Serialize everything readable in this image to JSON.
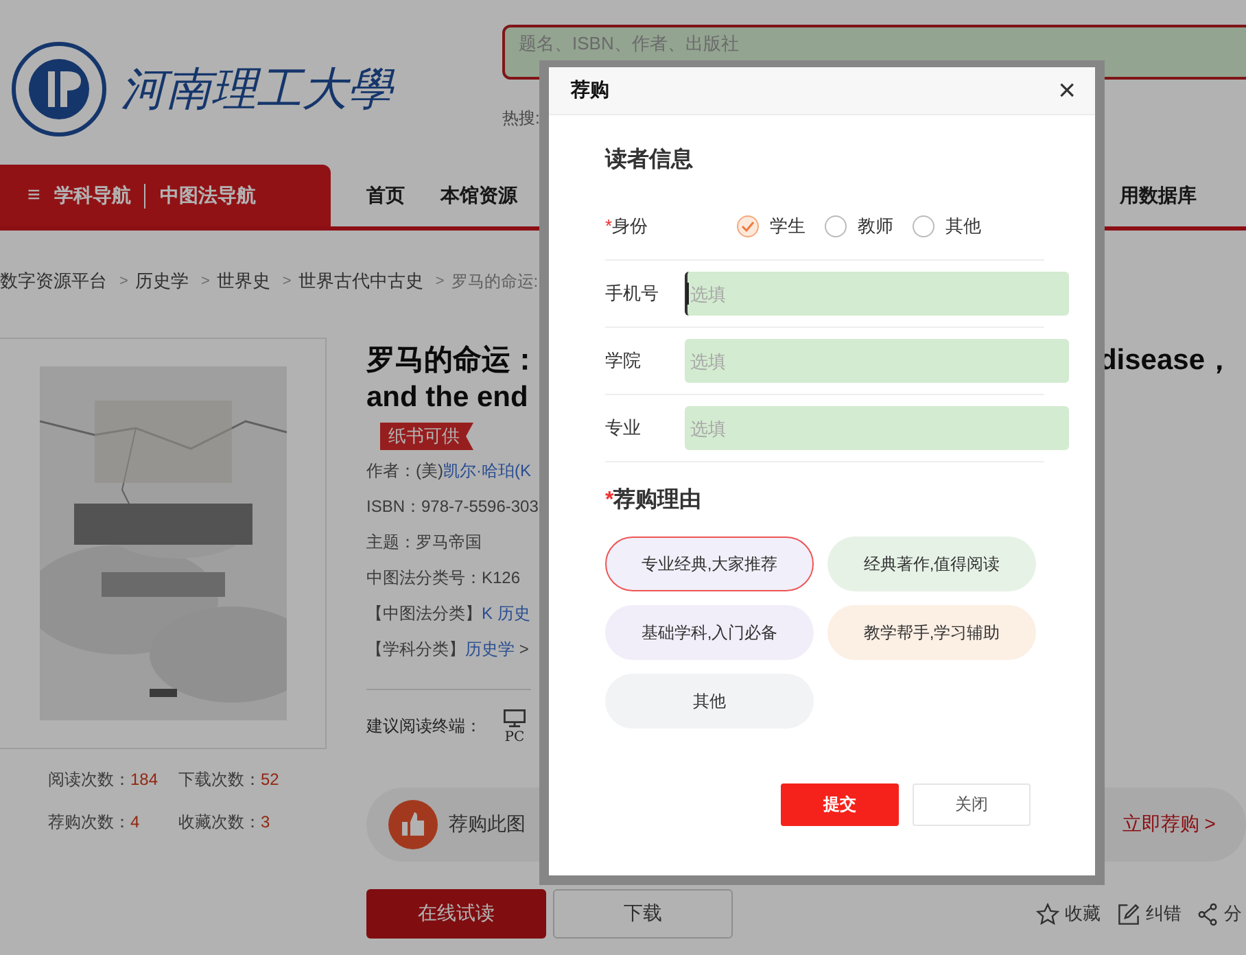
{
  "header": {
    "logo_text": "河南理工大學",
    "search": {
      "placeholder": "题名、ISBN、作者、出版社"
    },
    "hot_search_label": "热搜:"
  },
  "nav": {
    "menu_icon": "≡",
    "category_links": [
      "学科导航",
      "中图法导航"
    ],
    "items": [
      {
        "label": "首页"
      },
      {
        "label": "本馆资源"
      },
      {
        "label": "用数据库"
      }
    ]
  },
  "breadcrumb": [
    {
      "label": "数字资源平台"
    },
    {
      "separator": ">",
      "label": "历史学"
    },
    {
      "separator": ">",
      "label": "世界史"
    },
    {
      "separator": ">",
      "label": "世界古代中古史"
    },
    {
      "separator": ">",
      "label": "罗马的命运:"
    }
  ],
  "book": {
    "cover": {
      "kind": "picture"
    },
    "stats": [
      {
        "label": "阅读次数：",
        "value": "184"
      },
      {
        "label": "下载次数：",
        "value": "52"
      },
      {
        "label": "荐购次数：",
        "value": "4"
      },
      {
        "label": "收藏次数：",
        "value": "3"
      }
    ],
    "title_lines": [
      [
        "罗马的命运：",
        "disease，"
      ],
      [
        "and the end"
      ]
    ],
    "badge": "纸书可供",
    "meta": [
      {
        "label": "作者：(美)",
        "link": "凯尔·哈珀(K"
      },
      {
        "label": "ISBN：978-7-5596-303"
      },
      {
        "label": "主题：罗马帝国"
      },
      {
        "label": "中图法分类号：K126"
      },
      {
        "label": "【中图法分类】",
        "link": "K 历史"
      },
      {
        "label": "【学科分类】",
        "link": "历史学",
        "suffix": " >"
      }
    ],
    "reading_terminal": {
      "label": "建议阅读终端：",
      "devices": [
        {
          "label": "PC"
        }
      ]
    },
    "recommend_bar": {
      "text": "荐购此图",
      "action": "立即荐购 >"
    },
    "actions": [
      {
        "label": "在线试读",
        "kind": "primary"
      },
      {
        "label": "下载",
        "kind": "secondary"
      }
    ],
    "tools": [
      {
        "label": "收藏",
        "kind": "star"
      },
      {
        "label": "纠错",
        "kind": "edit"
      },
      {
        "label": "分",
        "kind": "share"
      }
    ]
  },
  "modal": {
    "title": "荐购",
    "close": "×",
    "reader": {
      "title": "读者信息",
      "identity": {
        "label": "身份",
        "required_mark": "*",
        "options": [
          {
            "label": "学生",
            "selected": true
          },
          {
            "label": "教师",
            "selected": false
          },
          {
            "label": "其他",
            "selected": false
          }
        ]
      },
      "fields": [
        {
          "label": "手机号",
          "placeholder": "选填",
          "focused": true
        },
        {
          "label": "学院",
          "placeholder": "选填",
          "focused": false
        },
        {
          "label": "专业",
          "placeholder": "选填",
          "focused": false
        }
      ]
    },
    "reason": {
      "title": "荐购理由",
      "required_mark": "*",
      "options": [
        {
          "label": "专业经典,大家推荐",
          "color": "#f1eff9",
          "selected": true
        },
        {
          "label": "经典著作,值得阅读",
          "color": "#e6f2e6",
          "selected": false
        },
        {
          "label": "基础学科,入门必备",
          "color": "#f1eefa",
          "selected": false
        },
        {
          "label": "教学帮手,学习辅助",
          "color": "#fcefe4",
          "selected": false
        },
        {
          "label": "其他",
          "color": "#f2f3f5",
          "selected": false
        }
      ]
    },
    "buttons": [
      {
        "label": "提交",
        "kind": "primary"
      },
      {
        "label": "关闭",
        "kind": "secondary"
      }
    ]
  }
}
